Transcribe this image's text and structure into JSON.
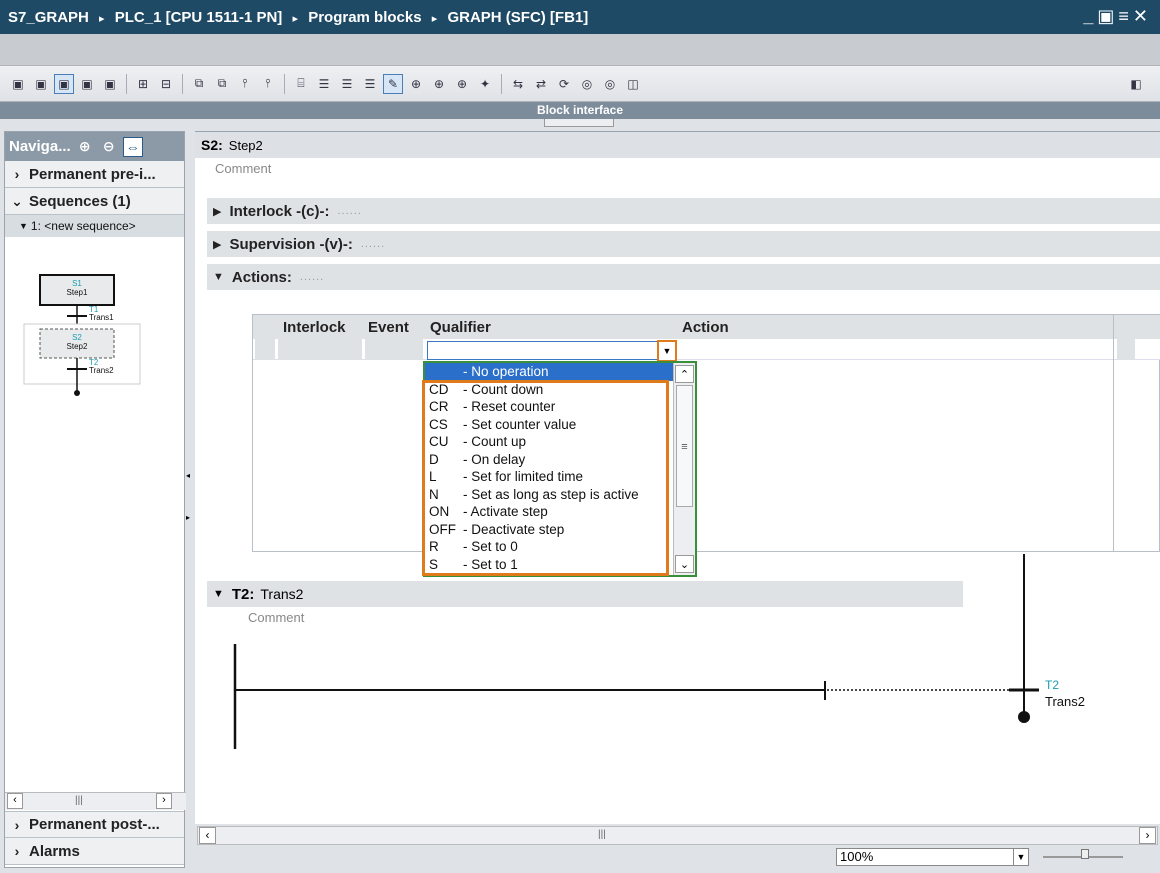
{
  "title": {
    "parts": [
      "S7_GRAPH",
      "PLC_1 [CPU 1511-1 PN]",
      "Program blocks",
      "GRAPH (SFC) [FB1]"
    ],
    "separator": "▸"
  },
  "toolbar": {
    "icons": [
      "view-icon",
      "view-icon",
      "view-active-icon",
      "view-icon",
      "view-icon",
      "insert-icon",
      "remove-icon",
      "step-icon",
      "step-icon",
      "transition-icon",
      "transition-icon",
      "branch-icon",
      "list-icon",
      "list-icon",
      "list-icon",
      "comment-icon",
      "network-icon",
      "network-icon",
      "network-icon",
      "navigation-icon",
      "link-icon",
      "unlink-icon",
      "sync-icon",
      "monitor-icon",
      "monitor-icon",
      "split-icon"
    ]
  },
  "block_interface": "Block interface",
  "navigation": {
    "title": "Naviga...",
    "permanent_pre": "Permanent pre-i...",
    "sequences": "Sequences (1)",
    "sequence_item": "1: <new sequence>",
    "permanent_post": "Permanent post-...",
    "alarms": "Alarms",
    "mini": {
      "s1_num": "S1",
      "s1_name": "Step1",
      "t1_num": "T1",
      "t1_name": "Trans1",
      "s2_num": "S2",
      "s2_name": "Step2",
      "t2_num": "T2",
      "t2_name": "Trans2"
    }
  },
  "step": {
    "label": "S2:",
    "name": "Step2",
    "comment": "Comment"
  },
  "sections": {
    "interlock": "Interlock -(c)-:",
    "interlock_dots": "......",
    "supervision": "Supervision -(v)-:",
    "supervision_dots": "......",
    "actions": "Actions:",
    "actions_dots": "......"
  },
  "action_table": {
    "headers": {
      "interlock": "Interlock",
      "event": "Event",
      "qualifier": "Qualifier",
      "action": "Action"
    },
    "qualifier_value": ""
  },
  "qualifier_options": [
    {
      "code": "",
      "text": "- No operation",
      "selected": true
    },
    {
      "code": "CD",
      "text": "- Count down"
    },
    {
      "code": "CR",
      "text": "- Reset counter"
    },
    {
      "code": "CS",
      "text": "- Set counter value"
    },
    {
      "code": "CU",
      "text": "- Count up"
    },
    {
      "code": "D",
      "text": "- On delay"
    },
    {
      "code": "L",
      "text": "- Set for limited time"
    },
    {
      "code": "N",
      "text": "- Set as long as step is active"
    },
    {
      "code": "ON",
      "text": "- Activate step"
    },
    {
      "code": "OFF",
      "text": "- Deactivate step"
    },
    {
      "code": "R",
      "text": "- Set to 0"
    },
    {
      "code": "S",
      "text": "- Set to 1"
    }
  ],
  "transition": {
    "label": "T2:",
    "name": "Trans2",
    "comment": "Comment",
    "num": "T2",
    "diagram_name": "Trans2"
  },
  "zoom": "100%",
  "colors": {
    "highlight": "#e07b1c",
    "selection": "#2a6fc9",
    "title_bg": "#1e4a66",
    "dropdown_border": "#3a8f3a",
    "transition_num": "#1a9fb0"
  }
}
